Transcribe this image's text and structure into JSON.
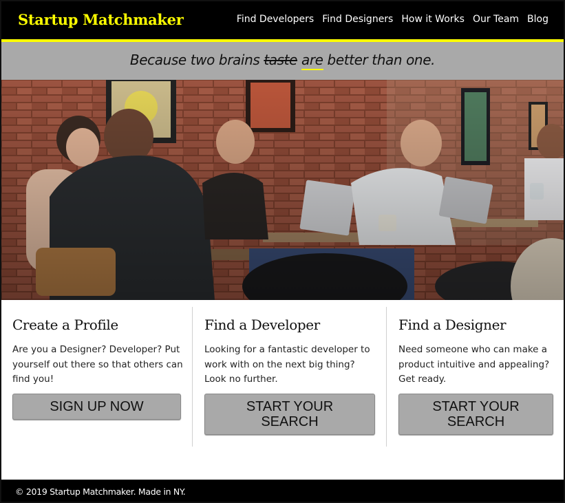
{
  "header": {
    "brand": "Startup Matchmaker",
    "nav": [
      "Find Developers",
      "Find Designers",
      "How it Works",
      "Our Team",
      "Blog"
    ],
    "accent_color": "#ffff00"
  },
  "tagline": {
    "part1": "Because two brains ",
    "struck": "taste",
    "space": " ",
    "underlined": "are",
    "part2": " better than one."
  },
  "hero": {
    "icon": "cafe-photo"
  },
  "cards": [
    {
      "title": "Create a Profile",
      "text": "Are you a Designer? Developer? Put yourself out there so that others can find you!",
      "button": "SIGN UP NOW"
    },
    {
      "title": "Find a Developer",
      "text": "Looking for a fantastic developer to work with on the next big thing? Look no further.",
      "button_line1": "START YOUR",
      "button_line2": "SEARCH"
    },
    {
      "title": "Find a Designer",
      "text": "Need someone who can make a product intuitive and appealing? Get ready.",
      "button_line1": "START YOUR",
      "button_line2": "SEARCH"
    }
  ],
  "footer": {
    "text": "© 2019 Startup Matchmaker. Made in NY."
  }
}
